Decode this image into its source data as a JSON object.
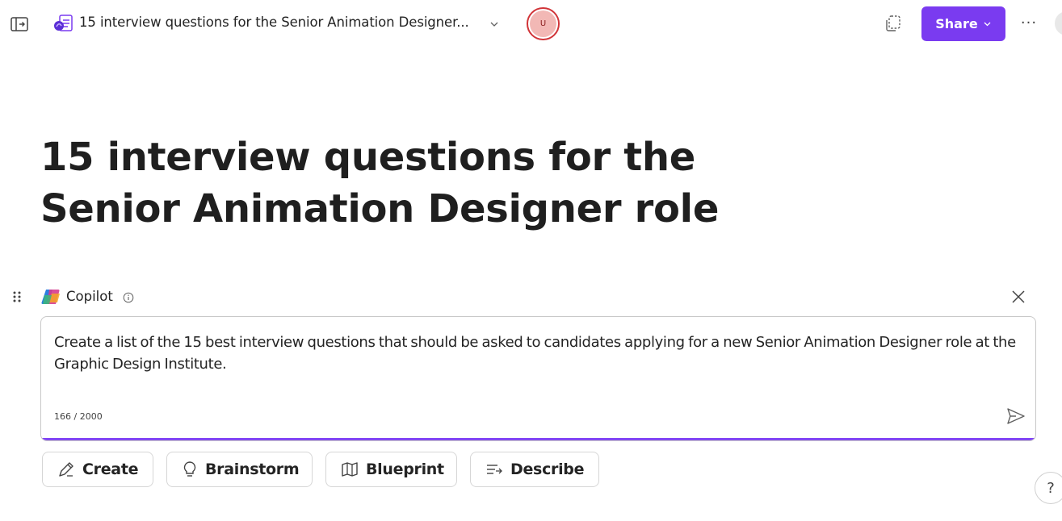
{
  "topbar": {
    "doc_title": "15 interview questions for the Senior Animation Designer...",
    "avatar_initial": "U",
    "share_label": "Share",
    "more_label": "···"
  },
  "page": {
    "title": "15 interview questions for the Senior Animation Designer role"
  },
  "copilot": {
    "label": "Copilot",
    "prompt_text": "Create a list of the 15 best interview questions that should be asked to candidates applying for a new Senior Animation Designer role at the Graphic Design Institute.",
    "char_count": "166 / 2000"
  },
  "actions": [
    {
      "label": "Create",
      "icon": "pen-sparkle-icon"
    },
    {
      "label": "Brainstorm",
      "icon": "lightbulb-icon"
    },
    {
      "label": "Blueprint",
      "icon": "map-icon"
    },
    {
      "label": "Describe",
      "icon": "text-arrow-icon"
    }
  ],
  "help": {
    "label": "?"
  },
  "colors": {
    "accent": "#7a3bf0",
    "prompt_underline": "#8246f5",
    "avatar_ring": "#d13438",
    "avatar_fill": "#f2b8b5"
  }
}
